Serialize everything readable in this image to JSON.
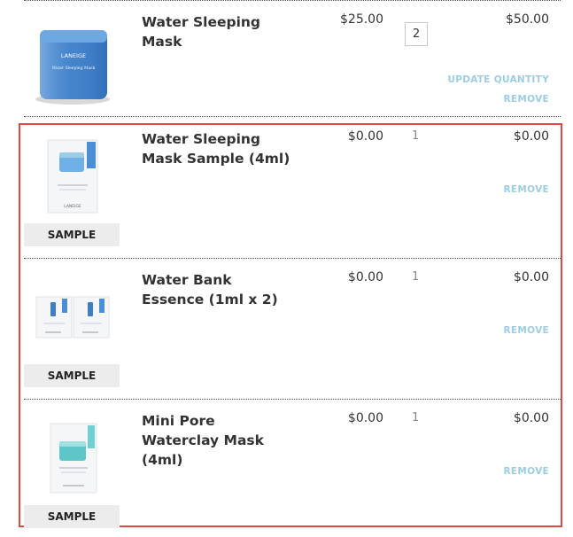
{
  "cart": {
    "main_item": {
      "name_line1": "Water Sleeping",
      "name_line2": "Mask",
      "price": "$25.00",
      "quantity": "2",
      "total": "$50.00",
      "update_label": "UPDATE QUANTITY",
      "remove_label": "REMOVE",
      "jar_brand": "LANEIGE",
      "jar_label": "Water Sleeping Mask"
    },
    "samples": [
      {
        "name_line1": "Water Sleeping",
        "name_line2": "Mask Sample (4ml)",
        "price": "$0.00",
        "quantity": "1",
        "total": "$0.00",
        "remove_label": "REMOVE",
        "badge": "SAMPLE"
      },
      {
        "name_line1": "Water Bank",
        "name_line2": "Essence (1ml x 2)",
        "price": "$0.00",
        "quantity": "1",
        "total": "$0.00",
        "remove_label": "REMOVE",
        "badge": "SAMPLE"
      },
      {
        "name_line1": "Mini Pore",
        "name_line2": "Waterclay Mask",
        "name_line3": "(4ml)",
        "price": "$0.00",
        "quantity": "1",
        "total": "$0.00",
        "remove_label": "REMOVE",
        "badge": "SAMPLE"
      }
    ],
    "sample_brand": "LANEIGE"
  },
  "colors": {
    "highlight_border": "#e04848",
    "link": "#9ccde6",
    "badge_bg": "#ececec"
  }
}
